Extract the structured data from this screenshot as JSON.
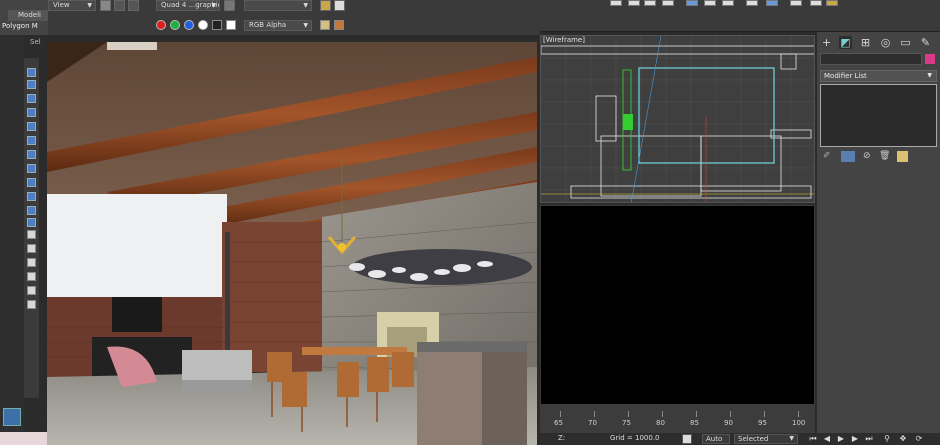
{
  "ribbon": {
    "tab_label": "Modeli",
    "sub_label": "Polygon M",
    "selection_label": "Sel"
  },
  "render_toolbar": {
    "view_dropdown": "View",
    "preset_dropdown": "Quad 4 ...graphic",
    "channel_dropdown": "RGB Alpha",
    "channel_colors": [
      "#e02020",
      "#20b040",
      "#2060e0",
      "#ffffff"
    ]
  },
  "wireframe_viewport": {
    "label": "[Wireframe]"
  },
  "timeline": {
    "ticks": [
      "65",
      "70",
      "75",
      "80",
      "85",
      "90",
      "95",
      "100"
    ]
  },
  "status_bar": {
    "z_label": "Z:",
    "grid_label": "Grid = 1000.0",
    "auto_label": "Auto",
    "selected_label": "Selected"
  },
  "command_panel": {
    "modifier_list_label": "Modifier List",
    "object_color": "#d93a8a",
    "tab_icons": [
      "create-icon",
      "modify-icon",
      "hierarchy-icon",
      "motion-icon",
      "display-icon",
      "utilities-icon"
    ]
  },
  "colors": {
    "accent": "#4f7fc2",
    "viewport_bg": "#3f3f3f",
    "wire_cyan": "#6fd8e0",
    "wire_green": "#33cc33"
  }
}
